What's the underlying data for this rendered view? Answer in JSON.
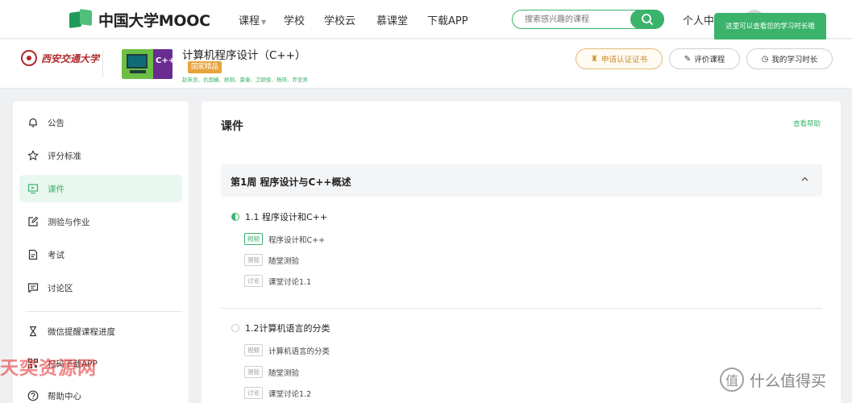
{
  "topnav": {
    "logo_text": "中国大学MOOC",
    "items": [
      {
        "label": "课程",
        "has_caret": true
      },
      {
        "label": "学校"
      },
      {
        "label": "学校云"
      },
      {
        "label": "慕课堂"
      },
      {
        "label": "下载APP"
      }
    ],
    "search_placeholder": "搜索感兴趣的课程",
    "user_center": "个人中心",
    "tooltip": "这里可以查看您的学习时长哦"
  },
  "course": {
    "university": "西安交通大学",
    "thumb_label": "C++",
    "title": "计算机程序设计（C++）",
    "badge": "国家精品",
    "teachers": "赵英良、仇国巍、顾刚、夏秦、卫颜俊、杨琦、乔亚男",
    "buttons": {
      "certificate": "申请认证证书",
      "review": "评价课程",
      "study_time": "我的学习时长"
    }
  },
  "sidebar": {
    "items": [
      {
        "label": "公告",
        "icon": "bell-icon"
      },
      {
        "label": "评分标准",
        "icon": "star-icon"
      },
      {
        "label": "课件",
        "icon": "courseware-icon",
        "active": true
      },
      {
        "label": "测验与作业",
        "icon": "edit-icon"
      },
      {
        "label": "考试",
        "icon": "document-icon"
      },
      {
        "label": "讨论区",
        "icon": "chat-icon"
      },
      {
        "label": "微信提醒课程进度",
        "icon": "hourglass-icon"
      },
      {
        "label": "扫码下载APP",
        "icon": "qrcode-icon"
      },
      {
        "label": "帮助中心",
        "icon": "help-icon"
      }
    ]
  },
  "main": {
    "title": "课件",
    "help_link": "查看帮助",
    "week": {
      "title": "第1周  程序设计与C++概述"
    },
    "lessons": [
      {
        "title": "1.1 程序设计和C++",
        "status": "in-progress",
        "units": [
          {
            "tag": "视频",
            "type": "video",
            "name": "程序设计和C++"
          },
          {
            "tag": "测验",
            "type": "quiz",
            "name": "随堂测验"
          },
          {
            "tag": "讨论",
            "type": "discussion",
            "name": "课堂讨论1.1"
          }
        ]
      },
      {
        "title": "1.2计算机语言的分类",
        "status": "not-started",
        "units": [
          {
            "tag": "视频",
            "type": "video",
            "name": "计算机语言的分类"
          },
          {
            "tag": "测验",
            "type": "quiz",
            "name": "随堂测验"
          },
          {
            "tag": "讨论",
            "type": "discussion",
            "name": "课堂讨论1.2"
          }
        ]
      }
    ]
  },
  "watermarks": {
    "left": "天奕资源网",
    "right_logo": "值",
    "right_text": "什么值得买"
  },
  "colors": {
    "accent": "#3bb36b",
    "badge": "#e8a33b",
    "certificate": "#c98a2a"
  }
}
